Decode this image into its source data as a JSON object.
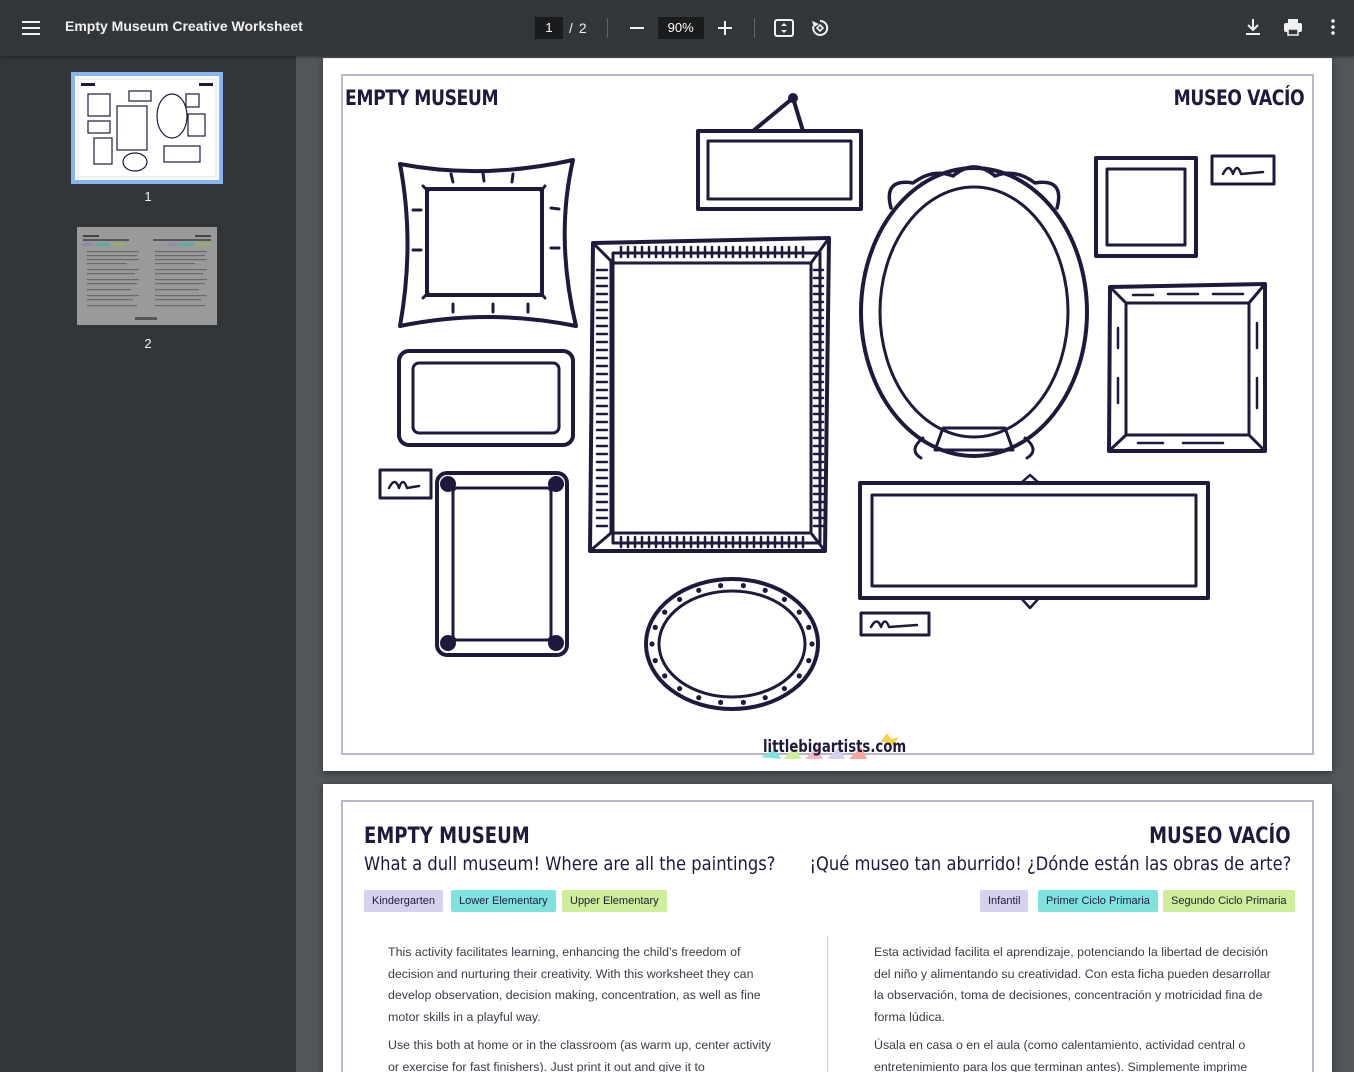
{
  "toolbar": {
    "title": "Empty Museum Creative Worksheet",
    "current_page": "1",
    "page_separator": "/",
    "total_pages": "2",
    "zoom": "90%",
    "icons": [
      "menu-icon",
      "zoom-out-icon",
      "zoom-in-icon",
      "fit-page-icon",
      "rotate-icon",
      "download-icon",
      "print-icon",
      "more-vert-icon"
    ]
  },
  "sidebar": {
    "thumbnails": [
      {
        "label": "1",
        "selected": true
      },
      {
        "label": "2",
        "selected": false
      }
    ]
  },
  "page1": {
    "title_en": "EMPTY MUSEUM",
    "title_es": "MUSEO VACÍO",
    "logo": "littlebigartists.com"
  },
  "page2": {
    "title_en": "EMPTY MUSEUM",
    "subtitle_en": "What a dull museum! Where are all the paintings?",
    "title_es": "MUSEO VACÍO",
    "subtitle_es": "¡Qué museo tan aburrido! ¿Dónde están las obras de arte?",
    "badges_en": [
      {
        "label": "Kindergarten",
        "color": "#d6d2ee"
      },
      {
        "label": "Lower Elementary",
        "color": "#7fe3dd"
      },
      {
        "label": "Upper Elementary",
        "color": "#cfee9a"
      }
    ],
    "badges_es": [
      {
        "label": "Infantil",
        "color": "#d6d2ee"
      },
      {
        "label": "Primer Ciclo Primaria",
        "color": "#7fe3dd"
      },
      {
        "label": "Segundo Ciclo Primaria",
        "color": "#cfee9a"
      }
    ],
    "para1_en": "This activity facilitates learning, enhancing the child’s freedom of decision and nurturing their creativity. With this worksheet they can develop observation, decision making, concentration, as well as fine motor skills in a playful way.",
    "para2_en": "Use this both at home or in the classroom (as warm up, center activity or exercise for fast finishers). Just print it out and give it to",
    "para1_es": "Esta actividad facilita el aprendizaje, potenciando la libertad de decisión del niño y alimentando su creatividad. Con esta ficha pueden desarrollar la observación, toma de decisiones, concentración y motricidad fina de forma lúdica.",
    "para2_es": "Úsala en casa o en el aula (como calentamiento, actividad central o entretenimiento para los que terminan antes). Simplemente imprime"
  }
}
